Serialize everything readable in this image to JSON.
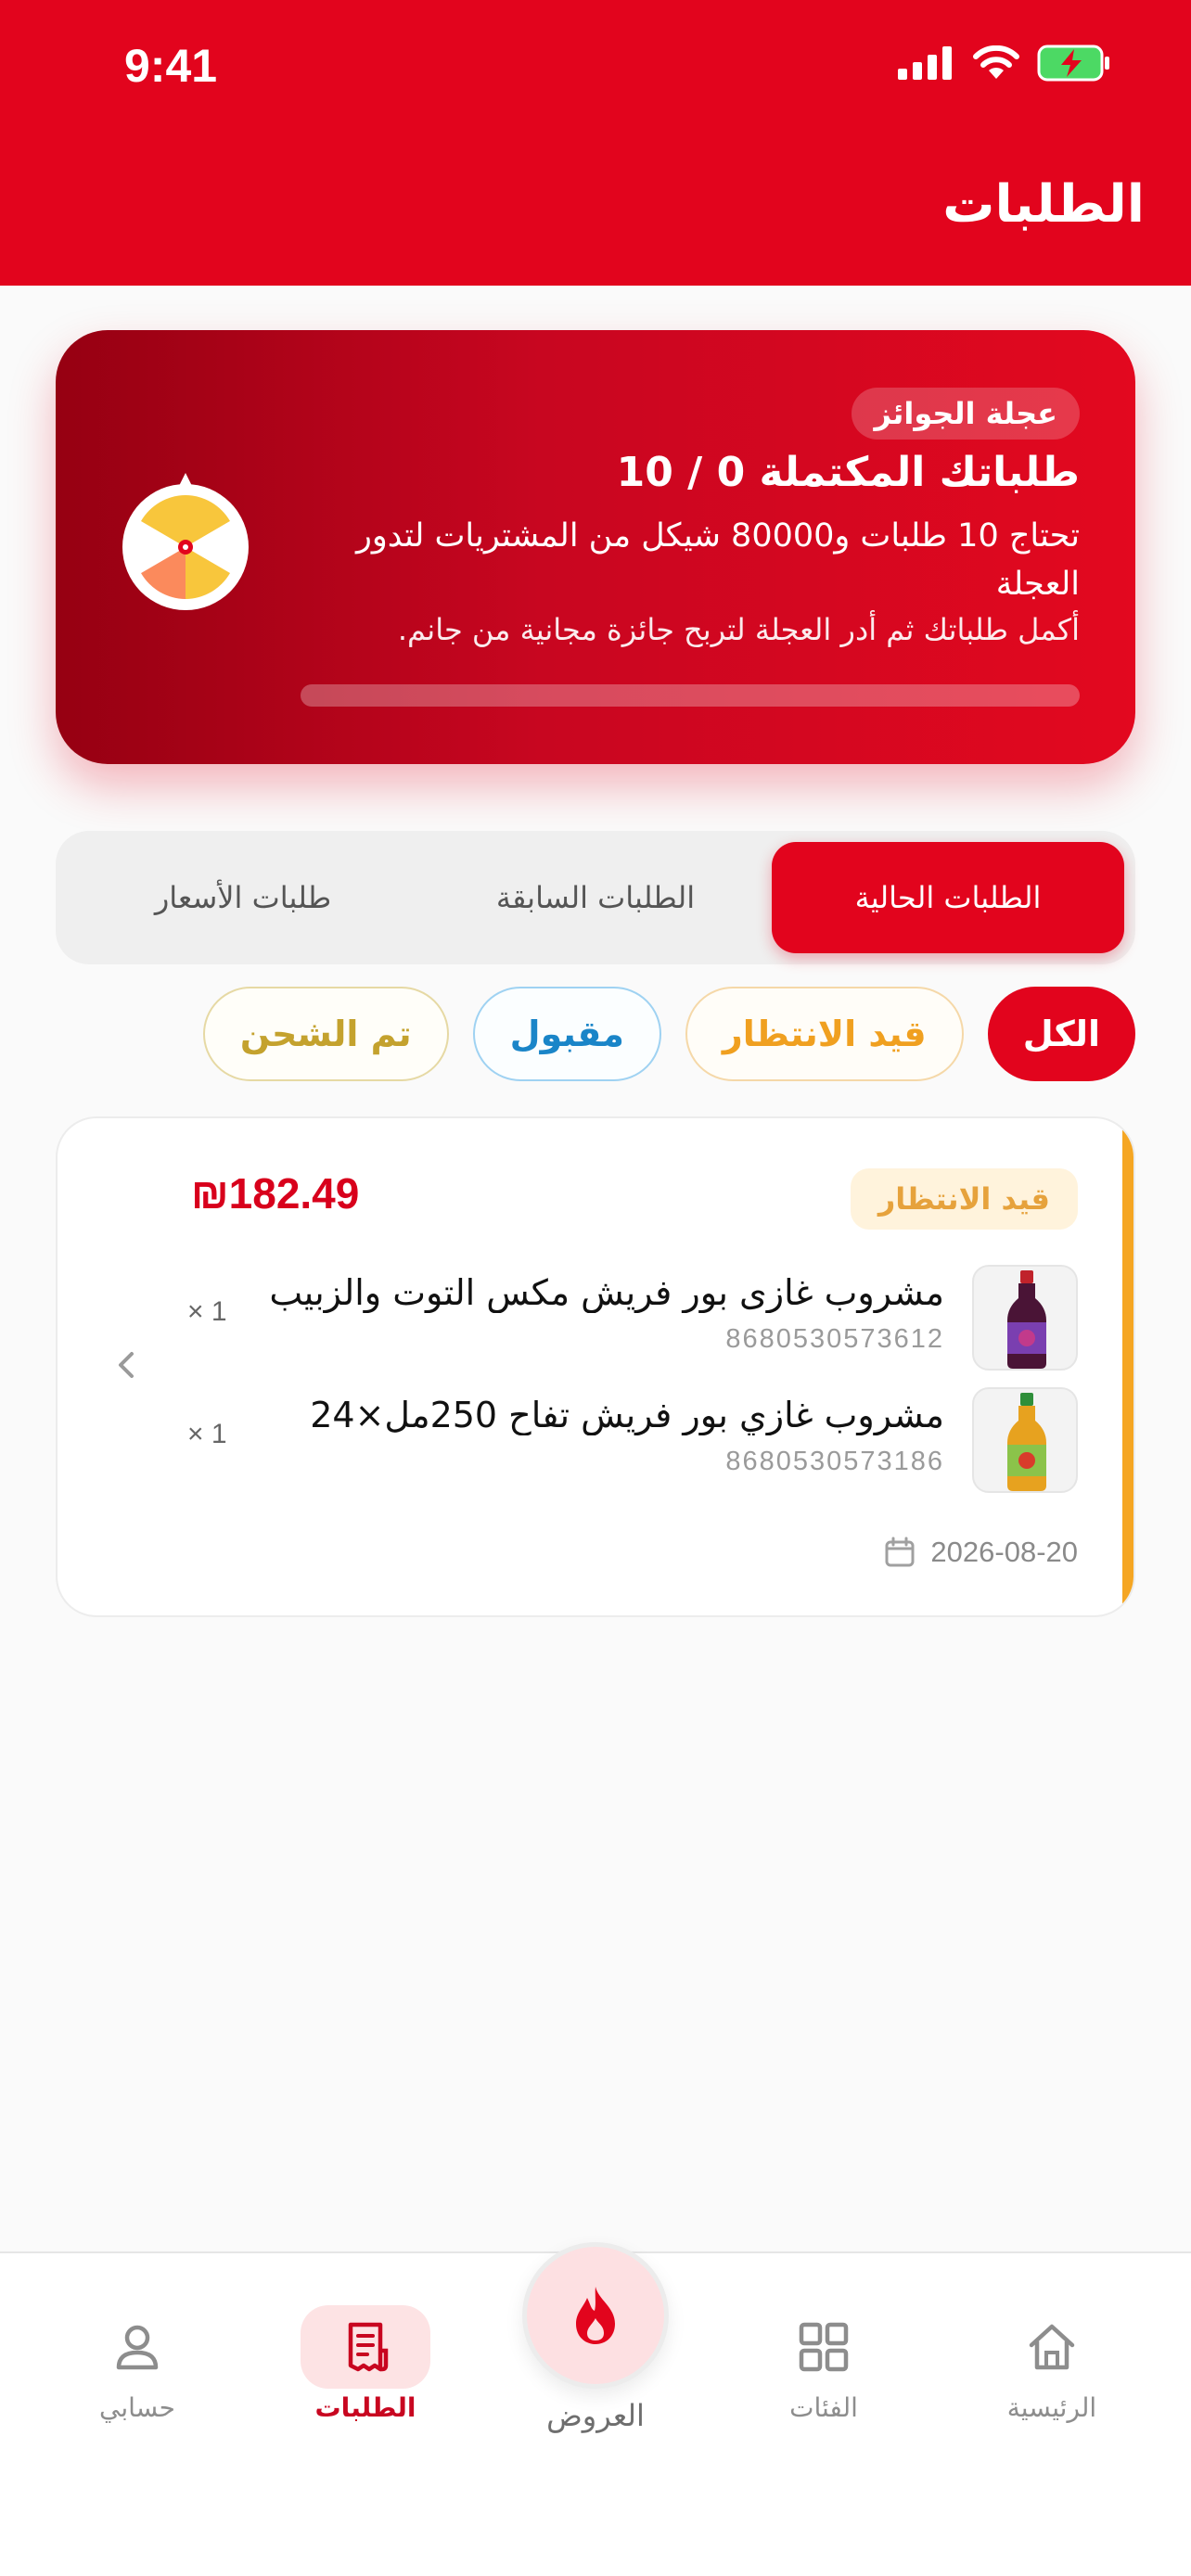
{
  "status_bar": {
    "time": "9:41"
  },
  "header": {
    "title": "الطلبات"
  },
  "wheel_card": {
    "badge": "عجلة الجوائز",
    "title": "طلباتك المكتملة 0 / 10",
    "description": "تحتاج 10 طلبات و80000 شيكل من المشتريات لتدور العجلة",
    "hint": "أكمل طلباتك ثم أدر العجلة لتربح جائزة مجانية من جانم.",
    "progress": 0,
    "colors": {
      "start": "#960012",
      "end": "#e3081f"
    }
  },
  "tabs": [
    {
      "label": "الطلبات الحالية",
      "active": true
    },
    {
      "label": "الطلبات السابقة",
      "active": false
    },
    {
      "label": "طلبات الأسعار",
      "active": false
    }
  ],
  "filters": [
    {
      "label": "الكل",
      "selected": true
    },
    {
      "label": "قيد الانتظار",
      "selected": false
    },
    {
      "label": "مقبول",
      "selected": false
    },
    {
      "label": "تم الشحن",
      "selected": false
    }
  ],
  "order": {
    "status": "قيد الانتظار",
    "total": "₪182.49",
    "date": "2026-08-20",
    "items": [
      {
        "name": "مشروب غازى بور فريش مكس التوت والزبيب ...",
        "sku": "8680530573612",
        "qty": "× 1"
      },
      {
        "name": "مشروب غازي بور فريش تفاح 250مل×24",
        "sku": "8680530573186",
        "qty": "× 1"
      }
    ]
  },
  "bottom_nav": {
    "items": [
      {
        "label": "الرئيسية",
        "icon": "home-icon"
      },
      {
        "label": "الفئات",
        "icon": "grid-icon"
      },
      {
        "label": "الطلبات",
        "icon": "receipt-icon",
        "active": true
      },
      {
        "label": "حسابي",
        "icon": "user-icon"
      }
    ],
    "fab_label": "العروض",
    "fab_icon": "flame-icon"
  },
  "colors": {
    "brand": "#e2041d",
    "pending": "#f5a623",
    "accepted": "#1a85c8",
    "shipped": "#c4a22e"
  }
}
